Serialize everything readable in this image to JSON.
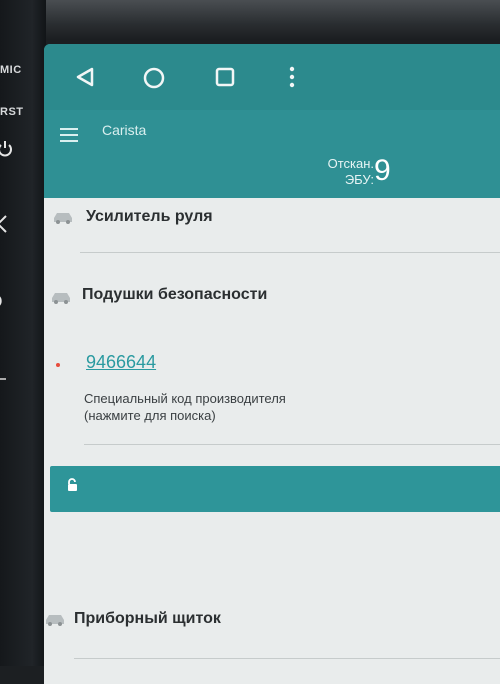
{
  "hardware": {
    "mic_label": "MIC",
    "rst_label": "RST"
  },
  "app": {
    "title": "Carista",
    "scan_label": "Отскан. ЭБУ:",
    "scan_count": "9"
  },
  "rows": [
    {
      "title": "Усилитель руля",
      "icon": "car-icon"
    },
    {
      "title": "Подушки безопасности",
      "icon": "car-icon"
    },
    {
      "title": "Приборный щиток",
      "icon": "car-icon"
    }
  ],
  "code_item": {
    "code": "9466644",
    "description": "Специальный код производителя (нажмите для поиска)"
  },
  "colors": {
    "accent": "#2f9094",
    "link": "#2a9aa0",
    "bullet": "#e74c3c"
  }
}
